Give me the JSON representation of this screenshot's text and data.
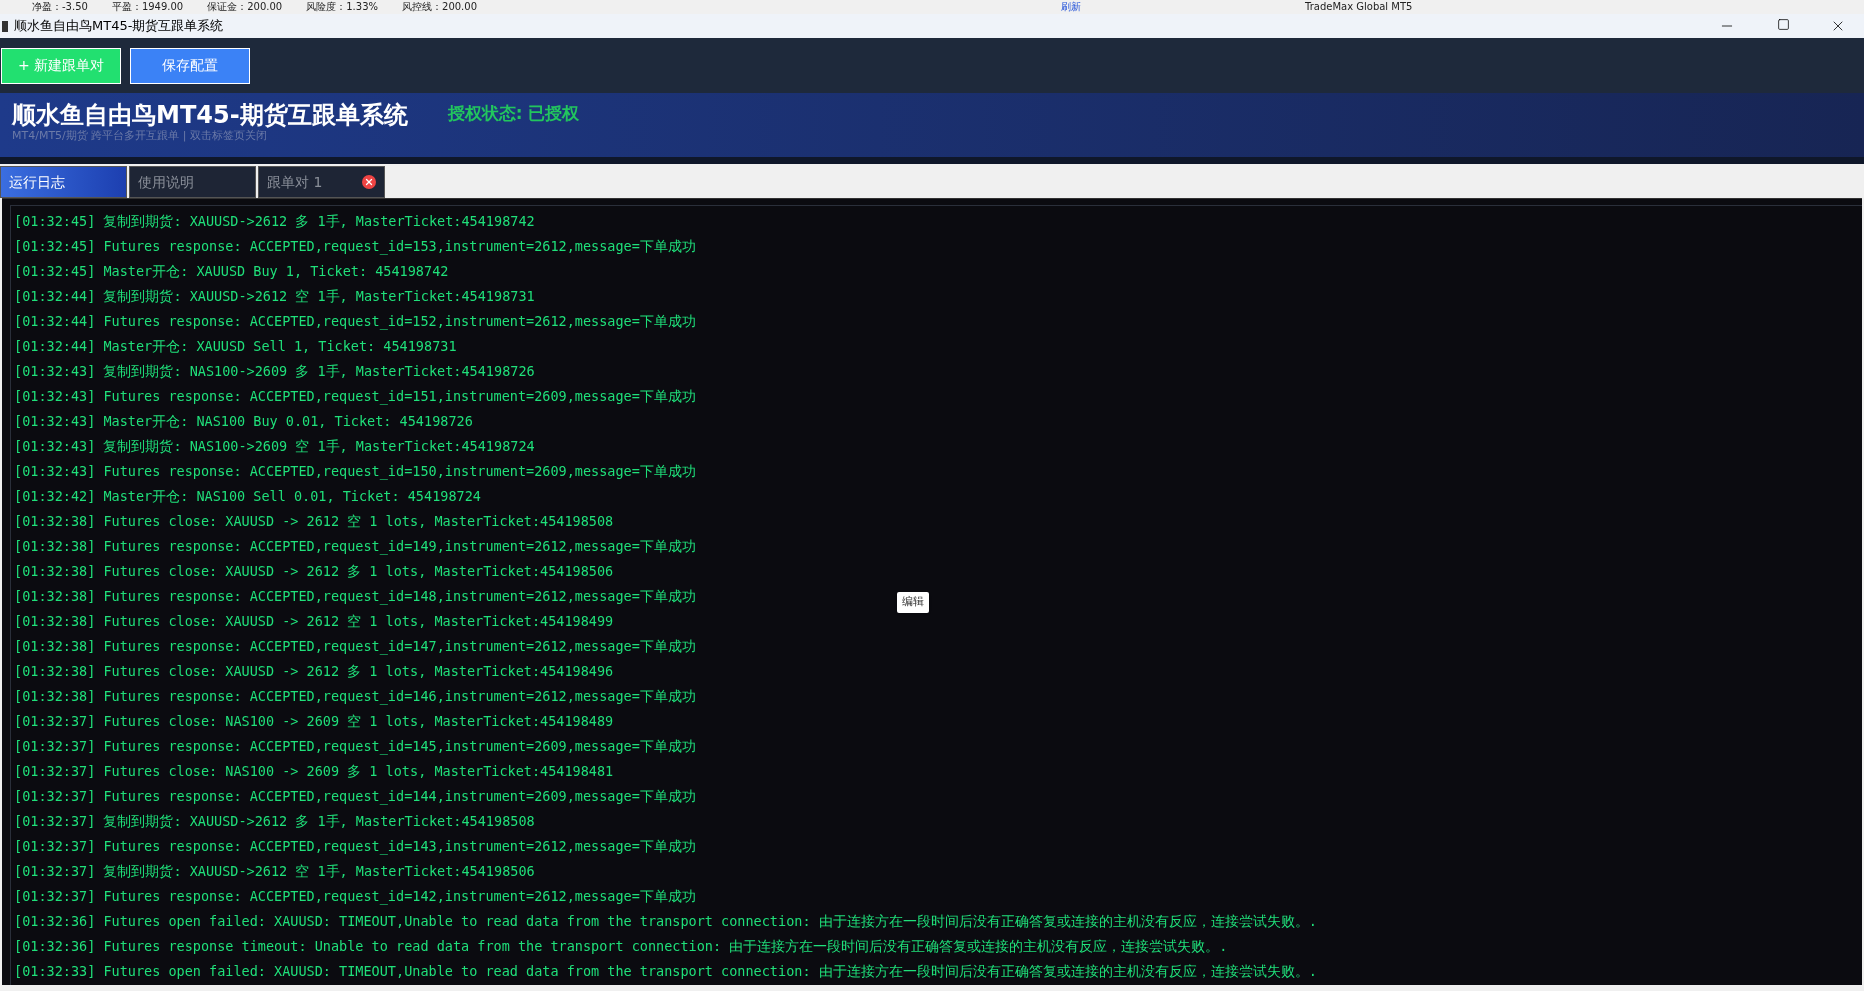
{
  "background_window": {
    "stats": [
      "净盈：-3.50",
      "平盈：1949.00",
      "保证金：200.00",
      "风险度：1.33%",
      "风控线：200.00"
    ],
    "refresh": "刷新",
    "terminal": "TradeMax Global MT5"
  },
  "window": {
    "title": "顺水鱼自由鸟MT45-期货互跟单系统"
  },
  "toolbar": {
    "buttons": [
      {
        "label": "+ 新建跟单对",
        "kind": "add"
      },
      {
        "label": "保存配置",
        "kind": "save"
      }
    ]
  },
  "banner": {
    "title": "顺水鱼自由鸟MT45-期货互跟单系统",
    "subtitle": "MT4/MT5/期货 跨平台多开互跟单 | 双击标签页关闭",
    "license_status": "授权状态: 已授权"
  },
  "tabs": [
    {
      "label": "运行日志",
      "selected": true,
      "closable": false
    },
    {
      "label": "使用说明",
      "selected": false,
      "closable": false
    },
    {
      "label": "跟单对 1",
      "selected": false,
      "closable": true
    }
  ],
  "log": [
    "[01:32:45] 复制到期货: XAUUSD->2612 多 1手, MasterTicket:454198742",
    "[01:32:45] Futures response: ACCEPTED,request_id=153,instrument=2612,message=下单成功",
    "[01:32:45] Master开仓: XAUUSD Buy 1, Ticket: 454198742",
    "[01:32:44] 复制到期货: XAUUSD->2612 空 1手, MasterTicket:454198731",
    "[01:32:44] Futures response: ACCEPTED,request_id=152,instrument=2612,message=下单成功",
    "[01:32:44] Master开仓: XAUUSD Sell 1, Ticket: 454198731",
    "[01:32:43] 复制到期货: NAS100->2609 多 1手, MasterTicket:454198726",
    "[01:32:43] Futures response: ACCEPTED,request_id=151,instrument=2609,message=下单成功",
    "[01:32:43] Master开仓: NAS100 Buy 0.01, Ticket: 454198726",
    "[01:32:43] 复制到期货: NAS100->2609 空 1手, MasterTicket:454198724",
    "[01:32:43] Futures response: ACCEPTED,request_id=150,instrument=2609,message=下单成功",
    "[01:32:42] Master开仓: NAS100 Sell 0.01, Ticket: 454198724",
    "[01:32:38] Futures close: XAUUSD -> 2612 空 1 lots, MasterTicket:454198508",
    "[01:32:38] Futures response: ACCEPTED,request_id=149,instrument=2612,message=下单成功",
    "[01:32:38] Futures close: XAUUSD -> 2612 多 1 lots, MasterTicket:454198506",
    "[01:32:38] Futures response: ACCEPTED,request_id=148,instrument=2612,message=下单成功",
    "[01:32:38] Futures close: XAUUSD -> 2612 空 1 lots, MasterTicket:454198499",
    "[01:32:38] Futures response: ACCEPTED,request_id=147,instrument=2612,message=下单成功",
    "[01:32:38] Futures close: XAUUSD -> 2612 多 1 lots, MasterTicket:454198496",
    "[01:32:38] Futures response: ACCEPTED,request_id=146,instrument=2612,message=下单成功",
    "[01:32:37] Futures close: NAS100 -> 2609 空 1 lots, MasterTicket:454198489",
    "[01:32:37] Futures response: ACCEPTED,request_id=145,instrument=2609,message=下单成功",
    "[01:32:37] Futures close: NAS100 -> 2609 多 1 lots, MasterTicket:454198481",
    "[01:32:37] Futures response: ACCEPTED,request_id=144,instrument=2609,message=下单成功",
    "[01:32:37] 复制到期货: XAUUSD->2612 多 1手, MasterTicket:454198508",
    "[01:32:37] Futures response: ACCEPTED,request_id=143,instrument=2612,message=下单成功",
    "[01:32:37] 复制到期货: XAUUSD->2612 空 1手, MasterTicket:454198506",
    "[01:32:37] Futures response: ACCEPTED,request_id=142,instrument=2612,message=下单成功",
    "[01:32:36] Futures open failed: XAUUSD: TIMEOUT,Unable to read data from the transport connection: 由于连接方在一段时间后没有正确答复或连接的主机没有反应，连接尝试失败。.",
    "[01:32:36] Futures response timeout: Unable to read data from the transport connection: 由于连接方在一段时间后没有正确答复或连接的主机没有反应，连接尝试失败。.",
    "[01:32:33] Futures open failed: XAUUSD: TIMEOUT,Unable to read data from the transport connection: 由于连接方在一段时间后没有正确答复或连接的主机没有反应，连接尝试失败。."
  ],
  "tooltip": "编辑"
}
